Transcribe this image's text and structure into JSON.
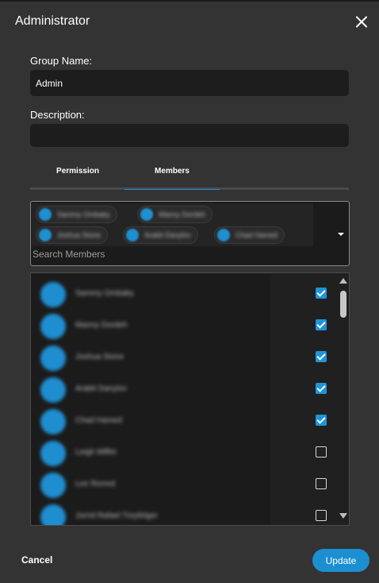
{
  "dialog": {
    "title": "Administrator"
  },
  "form": {
    "group_name_label": "Group Name:",
    "group_name_value": "Admin",
    "description_label": "Description:",
    "description_value": ""
  },
  "tabs": [
    {
      "label": "Permission",
      "active": false
    },
    {
      "label": "Members",
      "active": true
    }
  ],
  "members_select": {
    "chips": [
      "Sammy Ombaky",
      "Manny Dordeh",
      "Joshua Stone",
      "Arabit Danylov",
      "Chad Hamed"
    ],
    "search_placeholder": "Search Members"
  },
  "member_list": [
    {
      "name": "Sammy Ombaky",
      "checked": true
    },
    {
      "name": "Manny Dordeh",
      "checked": true
    },
    {
      "name": "Joshua Stone",
      "checked": true
    },
    {
      "name": "Arabit Danylov",
      "checked": true
    },
    {
      "name": "Chad Hamed",
      "checked": true
    },
    {
      "name": "Leigh Miffet",
      "checked": false
    },
    {
      "name": "Lee Rorred",
      "checked": false
    },
    {
      "name": "Jorrid Rafael Treyfelger",
      "checked": false
    }
  ],
  "footer": {
    "cancel_label": "Cancel",
    "update_label": "Update"
  },
  "colors": {
    "accent": "#1c8fd1",
    "dialog_bg": "#333333",
    "input_bg": "#1d1d1d"
  },
  "icons": [
    "close-icon",
    "chevron-down-icon",
    "scroll-up-icon",
    "scroll-down-icon",
    "checkbox-checked-icon",
    "checkbox-unchecked-icon"
  ]
}
